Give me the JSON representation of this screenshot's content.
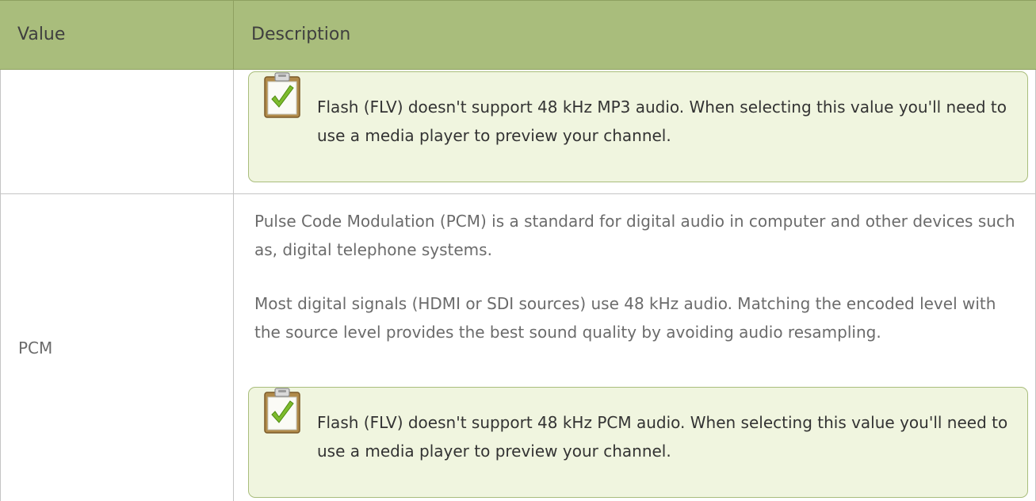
{
  "table": {
    "headers": {
      "value": "Value",
      "description": "Description"
    },
    "rows": [
      {
        "value": "",
        "paragraphs": [],
        "note": "Flash (FLV) doesn't support 48 kHz MP3 audio. When selecting this value you'll need to use a media player to preview your channel."
      },
      {
        "value": "PCM",
        "paragraphs": [
          "Pulse Code Modulation (PCM) is a standard for digital audio in computer and other devices such as, digital telephone systems.",
          "Most digital signals (HDMI or SDI sources) use 48 kHz audio. Matching the encoded level with the source level provides the best sound quality by avoiding audio resampling."
        ],
        "note": "Flash (FLV) doesn't support 48 kHz PCM audio. When selecting this value you'll need to use a media player to preview your channel."
      }
    ]
  },
  "colors": {
    "header_bg": "#a9bd7c",
    "note_bg": "#f0f5df",
    "note_border": "#a9bd7c",
    "text": "#6b6b6b"
  },
  "icons": {
    "note": "clipboard-check-icon"
  }
}
